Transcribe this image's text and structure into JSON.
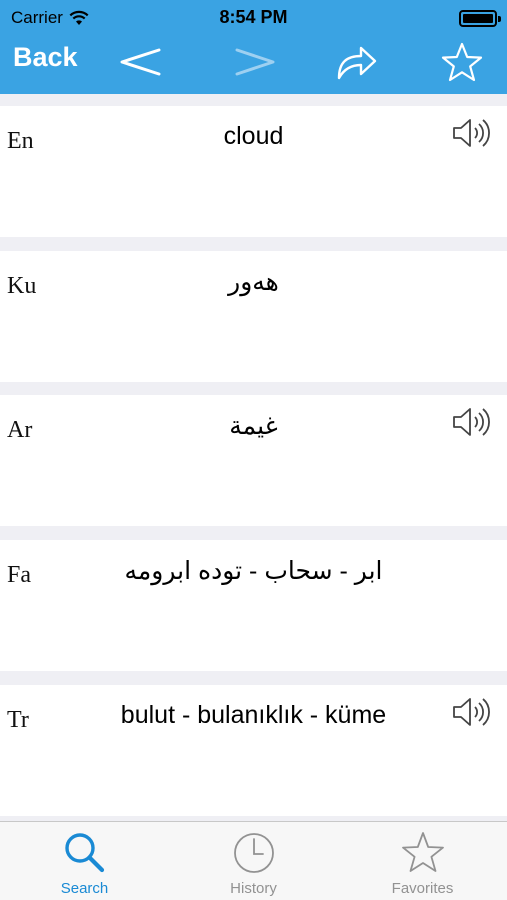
{
  "status_bar": {
    "carrier": "Carrier",
    "time": "8:54 PM"
  },
  "nav": {
    "back_label": "Back",
    "prev_symbol": "<",
    "next_symbol": ">",
    "accent_color": "#3aa3e3",
    "disabled_color": "#9dd0f1"
  },
  "translations": [
    {
      "lang": "En",
      "text": "cloud",
      "rtl": false,
      "speaker": true
    },
    {
      "lang": "Ku",
      "text": "هەور",
      "rtl": true,
      "speaker": false
    },
    {
      "lang": "Ar",
      "text": "غيمة",
      "rtl": true,
      "speaker": true
    },
    {
      "lang": "Fa",
      "text": "ابر - سحاب - توده ابرومه",
      "rtl": true,
      "speaker": false
    },
    {
      "lang": "Tr",
      "text": "bulut - bulanıklık - küme",
      "rtl": false,
      "speaker": true
    }
  ],
  "tabbar": {
    "active_color": "#1a8ad4",
    "inactive_color": "#929292",
    "tabs": [
      {
        "label": "Search",
        "icon": "search-icon",
        "active": true
      },
      {
        "label": "History",
        "icon": "clock-icon",
        "active": false
      },
      {
        "label": "Favorites",
        "icon": "star-icon",
        "active": false
      }
    ]
  }
}
